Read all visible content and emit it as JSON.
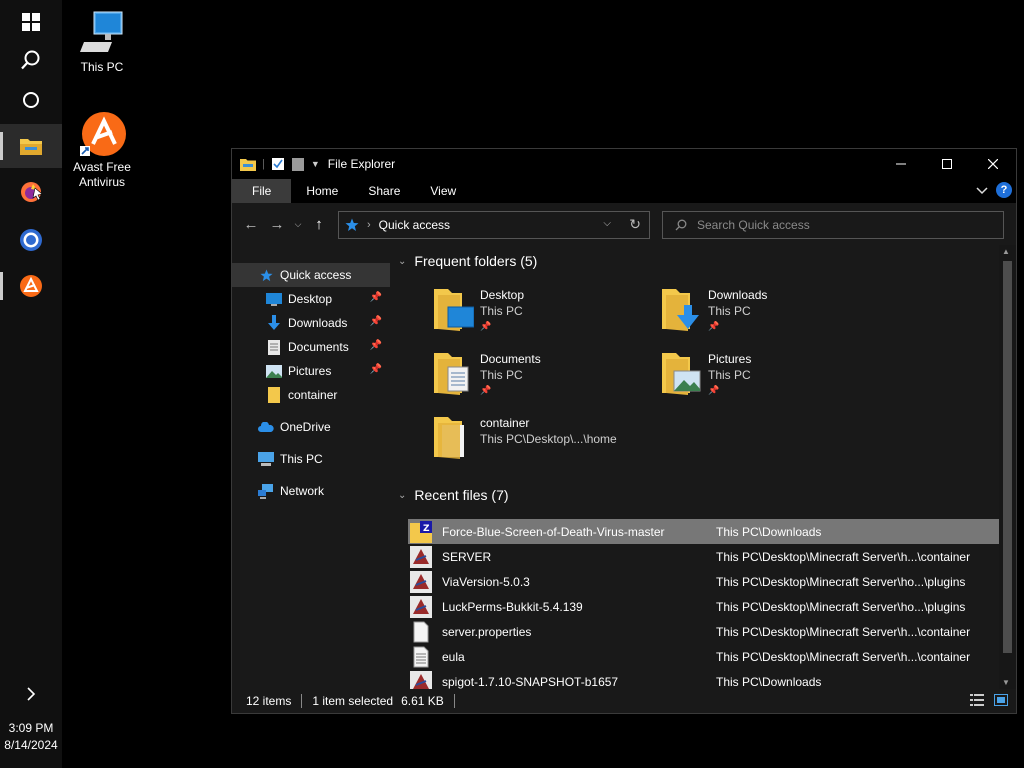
{
  "desktop": {
    "icons": [
      {
        "label": "This PC"
      },
      {
        "label": "Avast Free Antivirus"
      }
    ]
  },
  "taskbar": {
    "time": "3:09 PM",
    "date": "8/14/2024"
  },
  "window": {
    "title": "File Explorer",
    "ribbon_tabs": [
      "File",
      "Home",
      "Share",
      "View"
    ],
    "help_label": "?",
    "address": {
      "crumb": "Quick access"
    },
    "search": {
      "placeholder": "Search Quick access"
    },
    "nav_pane": {
      "quick_access": "Quick access",
      "pinned": [
        "Desktop",
        "Downloads",
        "Documents",
        "Pictures"
      ],
      "recent_folder": "container",
      "onedrive": "OneDrive",
      "this_pc": "This PC",
      "network": "Network"
    },
    "frequent": {
      "header": "Frequent folders (5)",
      "folders": [
        {
          "name": "Desktop",
          "path": "This PC"
        },
        {
          "name": "Downloads",
          "path": "This PC"
        },
        {
          "name": "Documents",
          "path": "This PC"
        },
        {
          "name": "Pictures",
          "path": "This PC"
        },
        {
          "name": "container",
          "path": "This PC\\Desktop\\...\\home"
        }
      ]
    },
    "recent": {
      "header": "Recent files (7)",
      "files": [
        {
          "name": "Force-Blue-Screen-of-Death-Virus-master",
          "path": "This PC\\Downloads"
        },
        {
          "name": "SERVER",
          "path": "This PC\\Desktop\\Minecraft Server\\h...\\container"
        },
        {
          "name": "ViaVersion-5.0.3",
          "path": "This PC\\Desktop\\Minecraft Server\\ho...\\plugins"
        },
        {
          "name": "LuckPerms-Bukkit-5.4.139",
          "path": "This PC\\Desktop\\Minecraft Server\\ho...\\plugins"
        },
        {
          "name": "server.properties",
          "path": "This PC\\Desktop\\Minecraft Server\\h...\\container"
        },
        {
          "name": "eula",
          "path": "This PC\\Desktop\\Minecraft Server\\h...\\container"
        },
        {
          "name": "spigot-1.7.10-SNAPSHOT-b1657",
          "path": "This PC\\Downloads"
        }
      ]
    },
    "status": {
      "items": "12 items",
      "selected": "1 item selected",
      "size": "6.61 KB"
    }
  },
  "colors": {
    "accent_blue": "#1e6fd9",
    "folder_yellow": "#f3c84b",
    "avast_orange": "#f96a16"
  }
}
